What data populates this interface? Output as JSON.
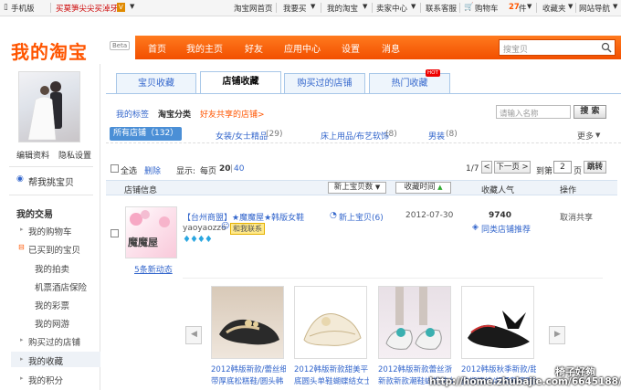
{
  "topbar": {
    "mobile": "手机版",
    "promo": "买莫笋尖尖买淖牙",
    "taobao_home": "淘宝网首页",
    "buy": "我要买",
    "my_taobao": "我的淘宝",
    "seller_center": "卖家中心",
    "support": "联系客服",
    "cart": "购物车",
    "cart_count": "27",
    "cart_unit": "件",
    "favorites": "收藏夹",
    "sitemap": "网站导航"
  },
  "header": {
    "logo": "我的淘宝",
    "beta": "Beta",
    "nav": [
      "首页",
      "我的主页",
      "好友",
      "应用中心",
      "设置",
      "消息"
    ],
    "search_placeholder": "搜宝贝"
  },
  "left": {
    "edit_profile": "编辑资料",
    "privacy": "隐私设置",
    "help_pick": "帮我挑宝贝",
    "my_trades": "我的交易",
    "cart": "我的购物车",
    "bought": "已买到的宝贝",
    "sub": [
      "我的拍卖",
      "机票酒店保险",
      "我的彩票",
      "我的网游"
    ],
    "bought_shops": "购买过的店铺",
    "favorites": "我的收藏",
    "points": "我的积分"
  },
  "tabs": {
    "items": [
      "宝贝收藏",
      "店铺收藏",
      "购买过的店铺",
      "热门收藏"
    ],
    "hot": "HOT"
  },
  "filter": {
    "my_tags": "我的标签",
    "taobao_cat": "淘宝分类",
    "friends_shared": "好友共享的店铺>",
    "search_placeholder": "请输入名称",
    "search_btn": "搜 索",
    "all_shops": "所有店铺（132）",
    "cats": [
      {
        "name": "女装/女士精品",
        "count": "(29)"
      },
      {
        "name": "床上用品/布艺软饰",
        "count": "(8)"
      },
      {
        "name": "男装",
        "count": "(8)"
      }
    ],
    "more": "更多"
  },
  "toolbar": {
    "select_all": "全选",
    "delete": "删除",
    "display": "显示:",
    "per_page": "每页",
    "page_size_20": "20",
    "page_size_40": "40",
    "page_indicator": "1/7",
    "next": "下一页",
    "goto": "到第",
    "page_value": "2",
    "page_unit": "页",
    "jump": "跳转"
  },
  "table": {
    "col_shop": "店铺信息",
    "new_items_btn": "新上宝贝数",
    "fav_time_btn": "收藏时间",
    "col_popularity": "收藏人气",
    "col_ops": "操作"
  },
  "shop": {
    "logo_text": "魔魔屋",
    "name": "【台州商盟】★魔魔屋★韩版女鞋",
    "owner": "yaoyaozzo",
    "contact": "和我联系",
    "new_items": "新上宝贝(6)",
    "fav_date": "2012-07-30",
    "popularity": "9740",
    "recommend": "同类店铺推荐",
    "cancel_share": "取消共享",
    "news": "5条新动态"
  },
  "products": [
    {
      "line1": "2012韩版新款/蕾丝细",
      "line2": "带厚底松糕鞋/圆头韩"
    },
    {
      "line1": "2012韩版新款甜美平",
      "line2": "底圆头单鞋蝴蝶结女士"
    },
    {
      "line1": "2012韩版新款蕾丝浙",
      "line2": "新款新款潮鞋蝴蝶结女"
    },
    {
      "line1": "2012韩版秋季新款/甜",
      "line2": "美蝴蝶结/超柔软底圆头"
    }
  ],
  "watermark": {
    "line1": "椅子好夠",
    "line2": "http://home.zhubajie.com/6645188/"
  }
}
